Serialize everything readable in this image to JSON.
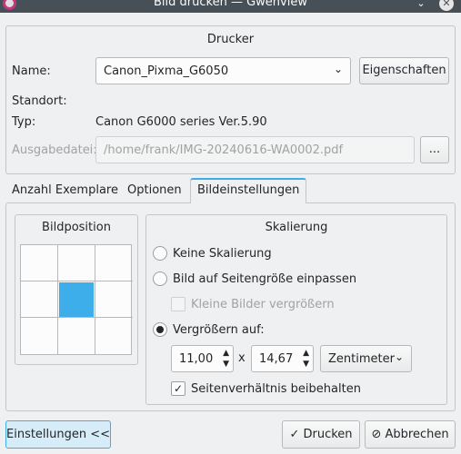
{
  "window": {
    "title": "Bild drucken — Gwenview",
    "minimize_icon": "chevron-down-icon",
    "close_icon": "close-icon"
  },
  "printer": {
    "group_title": "Drucker",
    "name_label": "Name:",
    "selected_printer": "Canon_Pixma_G6050",
    "properties_button": "Eigenschaften",
    "location_label": "Standort:",
    "location_value": "",
    "type_label": "Typ:",
    "type_value": "Canon G6000 series Ver.5.90",
    "output_file_label": "Ausgabedatei:",
    "output_file_value": "/home/frank/IMG-20240616-WA0002.pdf",
    "browse_button": "..."
  },
  "tabs": [
    {
      "label": "Anzahl Exemplare",
      "active": false
    },
    {
      "label": "Optionen",
      "active": false
    },
    {
      "label": "Bildeinstellungen",
      "active": true
    }
  ],
  "image_position": {
    "group_title": "Bildposition",
    "selected_cell": "center",
    "accent_color": "#3daee9"
  },
  "scaling": {
    "group_title": "Skalierung",
    "options": [
      {
        "label": "Keine Skalierung",
        "checked": false
      },
      {
        "label": "Bild auf Seitengröße einpassen",
        "checked": false
      },
      {
        "label": "Vergrößern auf:",
        "checked": true
      }
    ],
    "enlarge_small_label": "Kleine Bilder vergrößern",
    "enlarge_small_checked": false,
    "width_value": "11,00",
    "times_symbol": "x",
    "height_value": "14,67",
    "unit_selected": "Zentimeter",
    "keep_ratio_label": "Seitenverhältnis beibehalten",
    "keep_ratio_checked": true
  },
  "footer": {
    "settings_button": "Einstellungen <<",
    "print_button": "Drucken",
    "cancel_button": "Abbrechen"
  }
}
